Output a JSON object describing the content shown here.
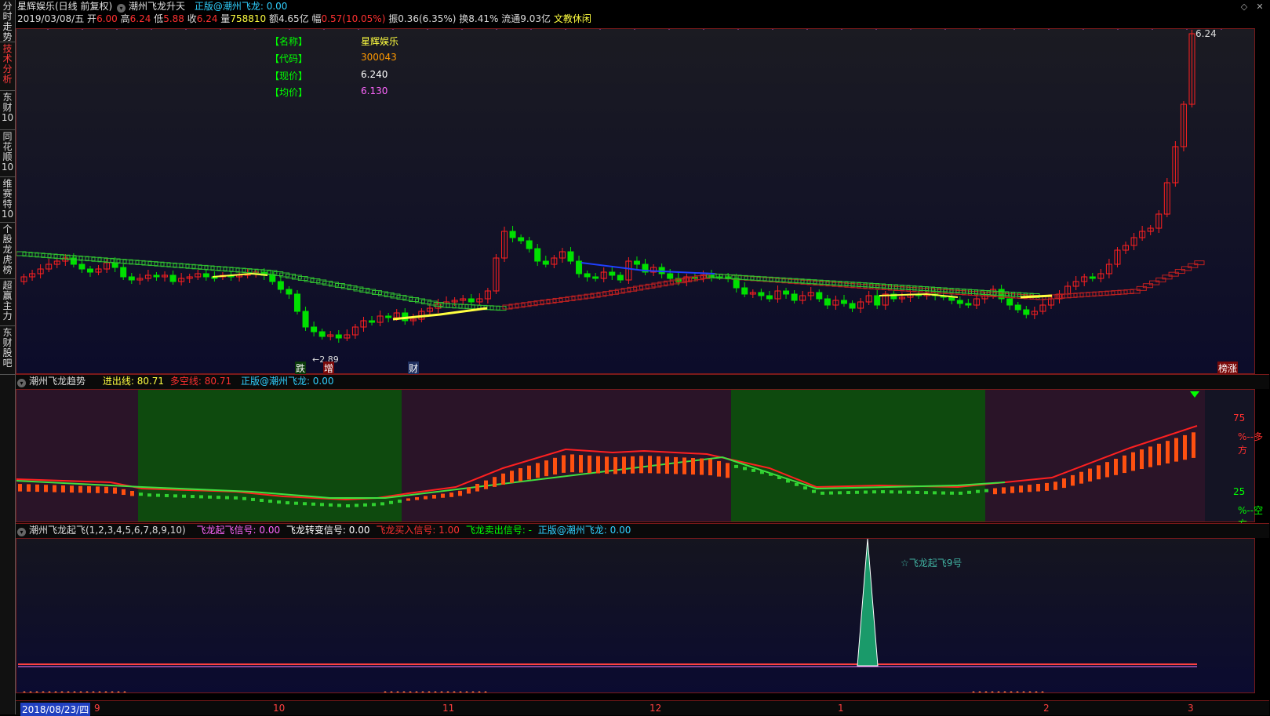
{
  "sidebar": {
    "tabs": [
      {
        "label": "分时走势",
        "active": false
      },
      {
        "label": "技术分析",
        "active": true
      },
      {
        "label": "东财10",
        "active": false
      },
      {
        "label": "同花顺10",
        "active": false
      },
      {
        "label": "维赛特10",
        "active": false
      },
      {
        "label": "个股龙虎榜",
        "active": false
      },
      {
        "label": "超赢主力",
        "active": false
      },
      {
        "label": "东财股吧",
        "active": false
      }
    ]
  },
  "header": {
    "title": "星辉娱乐(日线 前复权)",
    "indicator_name": "潮州飞龙升天",
    "indicator_text": "正版@潮州飞龙: 0.00",
    "date": "2019/03/08/五",
    "open_label": "开",
    "open": "6.00",
    "high_label": "高",
    "high": "6.24",
    "low_label": "低",
    "low": "5.88",
    "close_label": "收",
    "close": "6.24",
    "vol_label": "量",
    "vol": "758810",
    "amt_label": "额",
    "amt": "4.65亿",
    "chg_label": "幅",
    "chg": "0.57(10.05%)",
    "amp_label": "振",
    "amp": "0.36(6.35%)",
    "turn_label": "换",
    "turn": "8.41%",
    "float_label": "流通",
    "float": "9.03亿",
    "sector": "文教休闲"
  },
  "info_box": {
    "name_label": "【名称】",
    "name": "星辉娱乐",
    "code_label": "【代码】",
    "code": "300043",
    "price_label": "【现价】",
    "price": "6.240",
    "avg_label": "【均价】",
    "avg": "6.130"
  },
  "main_chart": {
    "high_label": "6.24",
    "low_label": "2.89",
    "markers": [
      {
        "text": "跌"
      },
      {
        "text": "增"
      },
      {
        "text": "财"
      },
      {
        "text": "榜涨"
      }
    ]
  },
  "pane2": {
    "title": "潮州飞龙趋势",
    "in_out_label": "进出线: 80.71",
    "long_short_label": "多空线: 80.71",
    "copyright": "正版@潮州飞龙: 0.00",
    "level_high": "75",
    "level_low": "25",
    "bull_text": "%--多方",
    "bear_text": "%--空方"
  },
  "pane3": {
    "title": "潮州飞龙起飞(1,2,3,4,5,6,7,8,9,10)",
    "takeoff": "飞龙起飞信号: 0.00",
    "turn": "飞龙转变信号: 0.00",
    "buy": "飞龙买入信号: 1.00",
    "sell": "飞龙卖出信号: -",
    "copyright": "正版@潮州飞龙: 0.00",
    "peak_label": "☆飞龙起飞9号"
  },
  "xaxis": {
    "cursor_date": "2018/08/23/四",
    "months": [
      "9",
      "10",
      "11",
      "12",
      "1",
      "2",
      "3"
    ]
  },
  "colors": {
    "up": "#ff2020",
    "down": "#00e000",
    "accent": "#ff3b3b",
    "cyan": "#30d0ff"
  }
}
